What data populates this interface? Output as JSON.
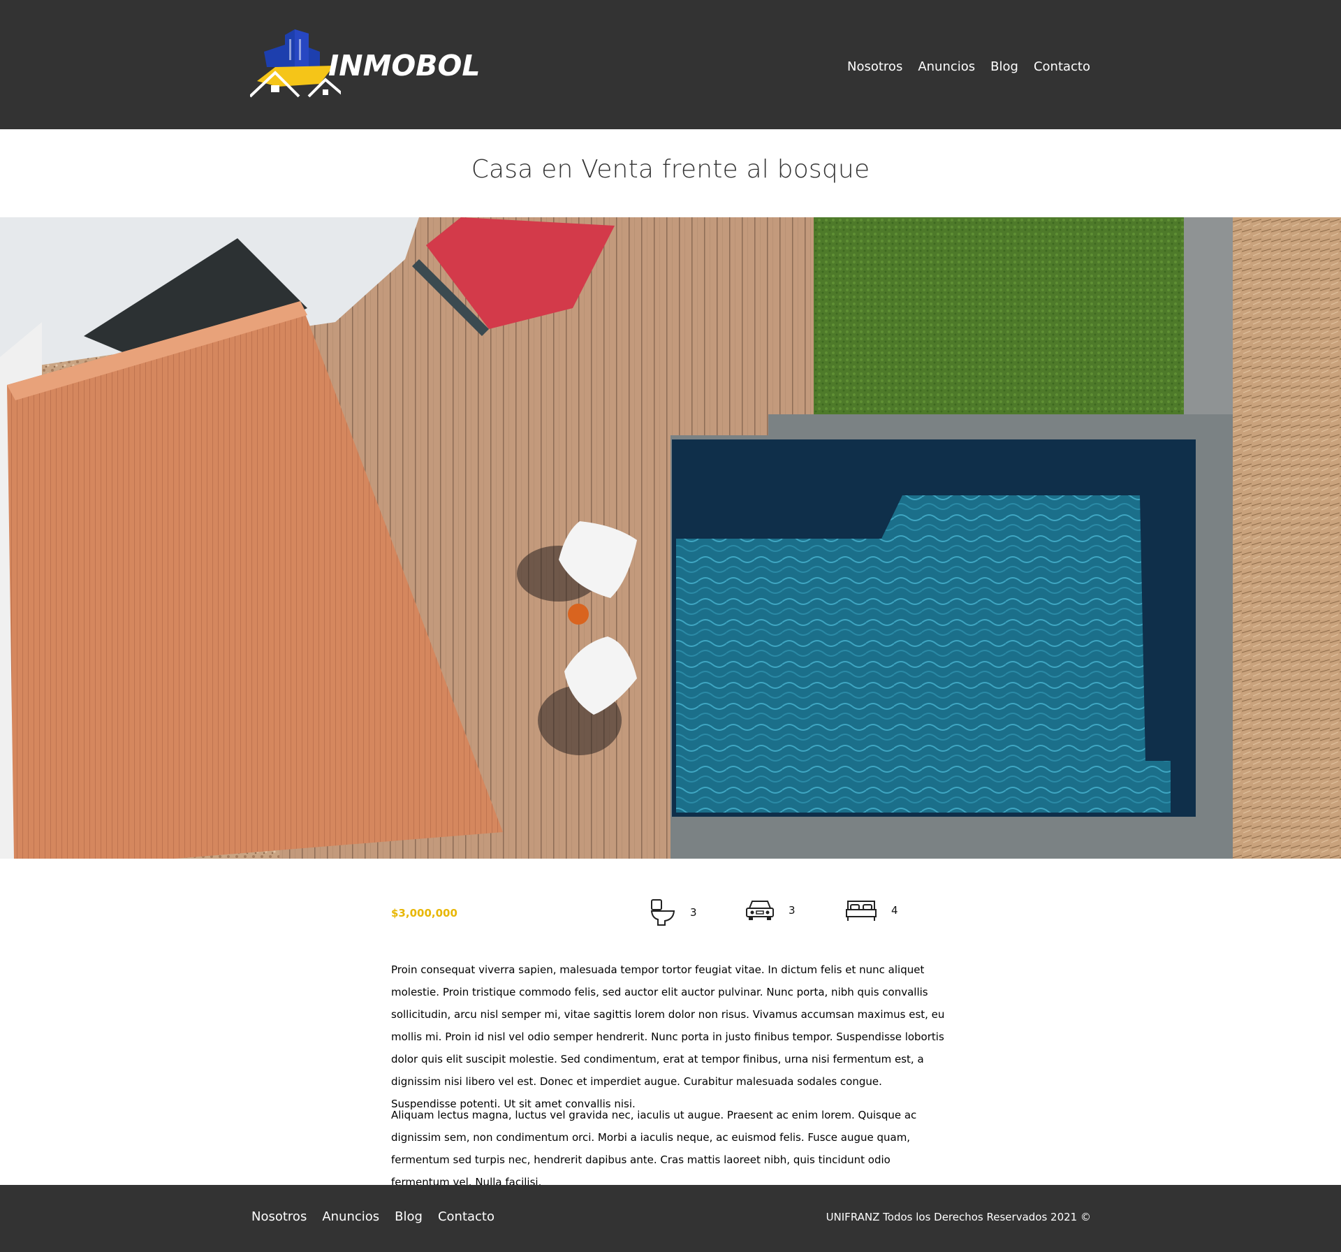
{
  "header": {
    "logo_text": "INMOBOL",
    "nav": [
      "Nosotros",
      "Anuncios",
      "Blog",
      "Contacto"
    ]
  },
  "page": {
    "title": "Casa en Venta frente al bosque"
  },
  "hero": {
    "image": "aerial-house-pool"
  },
  "property": {
    "price": "$3,000,000",
    "features": {
      "bathrooms": "3",
      "parking": "3",
      "bedrooms": "4"
    },
    "icons": {
      "bathrooms": "toilet-icon",
      "parking": "car-icon",
      "bedrooms": "bed-icon"
    },
    "description": [
      "Proin consequat viverra sapien, malesuada tempor tortor feugiat vitae. In dictum felis et nunc aliquet molestie. Proin tristique commodo felis, sed auctor elit auctor pulvinar. Nunc porta, nibh quis convallis sollicitudin, arcu nisl semper mi, vitae sagittis lorem dolor non risus. Vivamus accumsan maximus est, eu mollis mi. Proin id nisl vel odio semper hendrerit. Nunc porta in justo finibus tempor. Suspendisse lobortis dolor quis elit suscipit molestie. Sed condimentum, erat at tempor finibus, urna nisi fermentum est, a dignissim nisi libero vel est. Donec et imperdiet augue. Curabitur malesuada sodales congue. Suspendisse potenti. Ut sit amet convallis nisi.",
      "Aliquam lectus magna, luctus vel gravida nec, iaculis ut augue. Praesent ac enim lorem. Quisque ac dignissim sem, non condimentum orci. Morbi a iaculis neque, ac euismod felis. Fusce augue quam, fermentum sed turpis nec, hendrerit dapibus ante. Cras mattis laoreet nibh, quis tincidunt odio fermentum vel. Nulla facilisi."
    ]
  },
  "colors": {
    "header_bg": "#333333",
    "price": "#e8b706",
    "logo_blue": "#1d3fae",
    "logo_yellow": "#f5c518"
  },
  "footer": {
    "nav": [
      "Nosotros",
      "Anuncios",
      "Blog",
      "Contacto"
    ],
    "copyright": "UNIFRANZ Todos los Derechos Reservados 2021 ©"
  }
}
